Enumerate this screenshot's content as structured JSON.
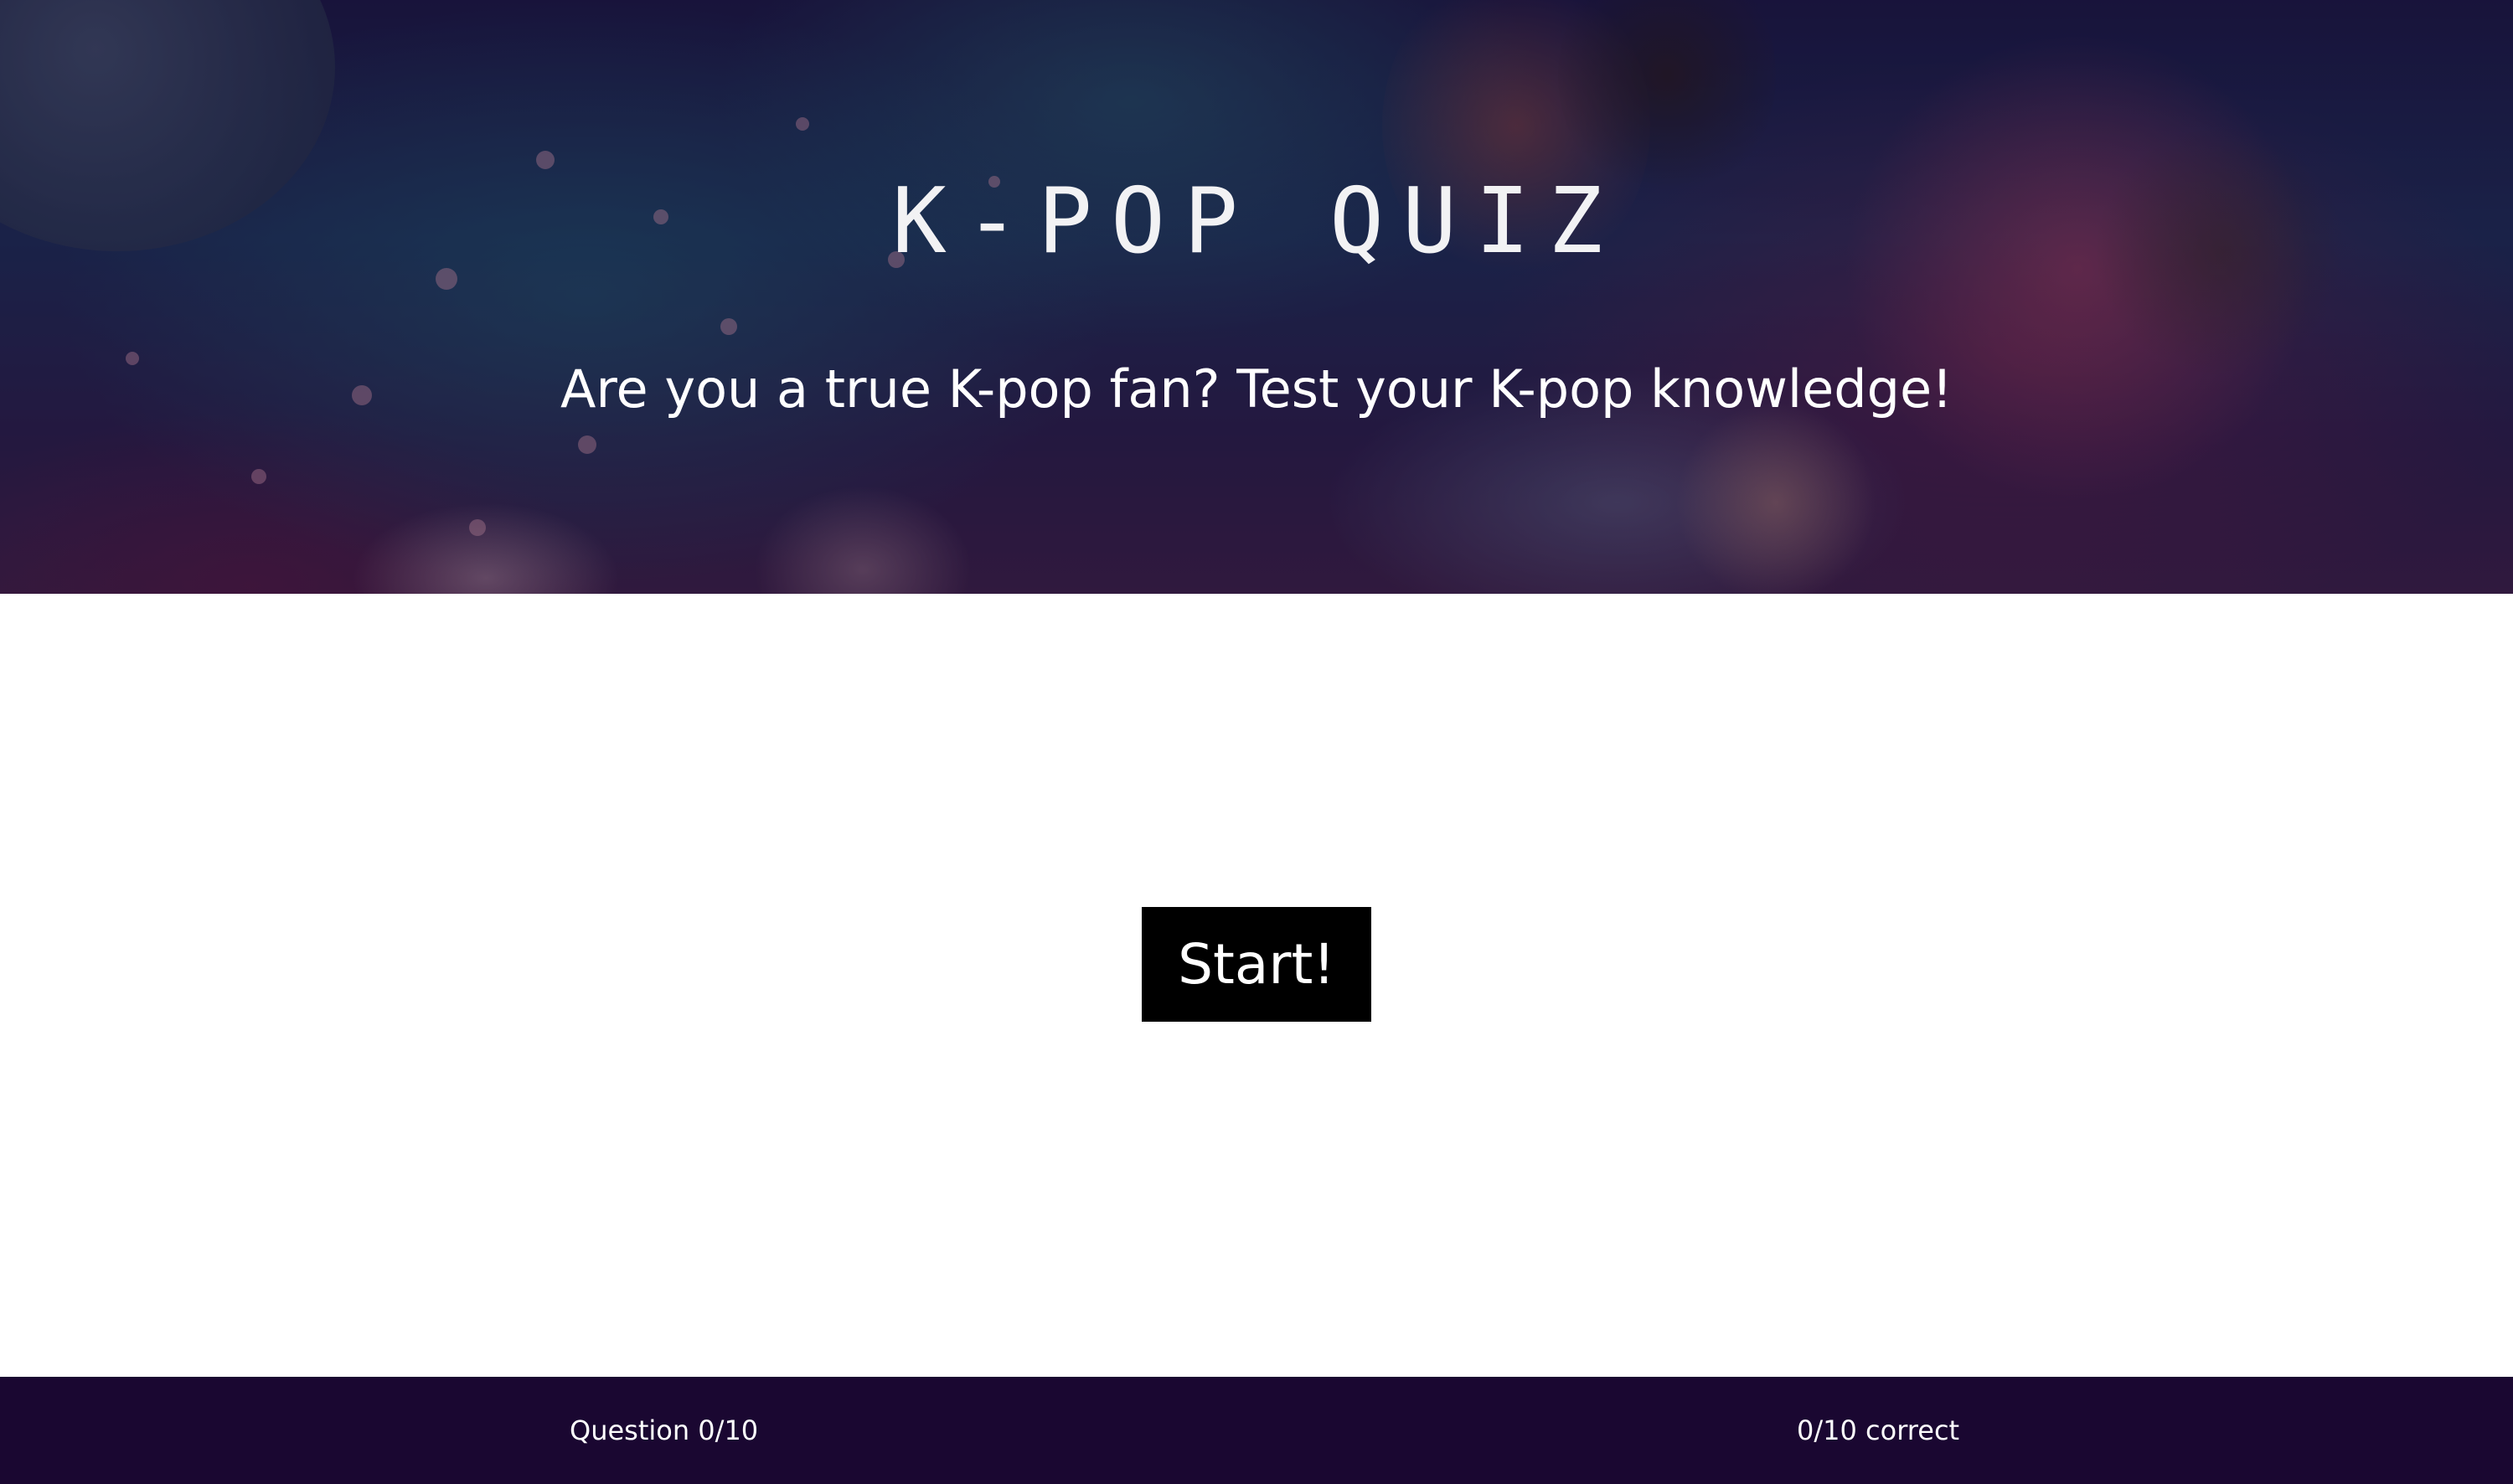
{
  "hero": {
    "title": "K-POP QUIZ",
    "subtitle": "Are you a true K-pop fan? Test your K-pop knowledge!"
  },
  "main": {
    "start_label": "Start!"
  },
  "footer": {
    "question_progress": "Question 0/10",
    "score": "0/10 correct"
  },
  "colors": {
    "footer_bg": "#1a0731",
    "button_bg": "#000000",
    "text_light": "#ffffff"
  }
}
